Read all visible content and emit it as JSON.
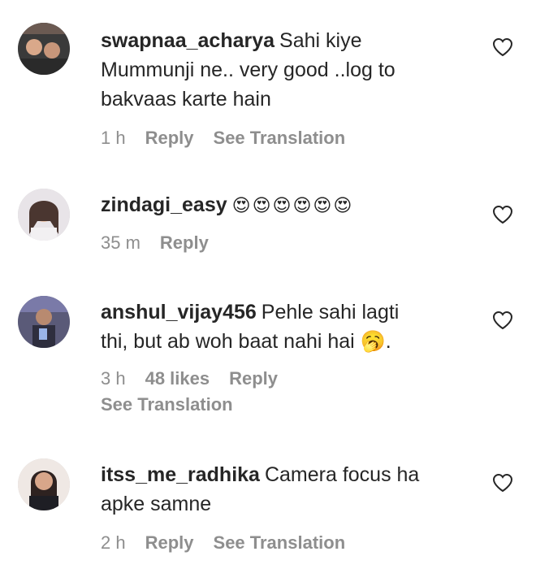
{
  "comments": [
    {
      "username": "swapnaa_acharya",
      "text_lines": [
        "Sahi kiye",
        "Mummunji ne.. very good ..log to",
        "bakvaas karte hain"
      ],
      "time": "1 h",
      "likes": "",
      "reply": "Reply",
      "translation": "See Translation"
    },
    {
      "username": "zindagi_easy",
      "text_lines": [
        "😍😍😍😍😍😍"
      ],
      "time": "35 m",
      "likes": "",
      "reply": "Reply",
      "translation": ""
    },
    {
      "username": "anshul_vijay456",
      "text_lines": [
        "Pehle sahi lagti",
        "thi, but ab woh baat nahi hai 🥱."
      ],
      "time": "3 h",
      "likes": "48 likes",
      "reply": "Reply",
      "translation": "See Translation"
    },
    {
      "username": "itss_me_radhika",
      "text_lines": [
        "Camera focus ha",
        "apke samne"
      ],
      "time": "2 h",
      "likes": "",
      "reply": "Reply",
      "translation": "See Translation"
    }
  ],
  "icons": {
    "like": "heart-outline-icon"
  },
  "colors": {
    "text": "#262626",
    "meta": "#8e8e8e"
  }
}
